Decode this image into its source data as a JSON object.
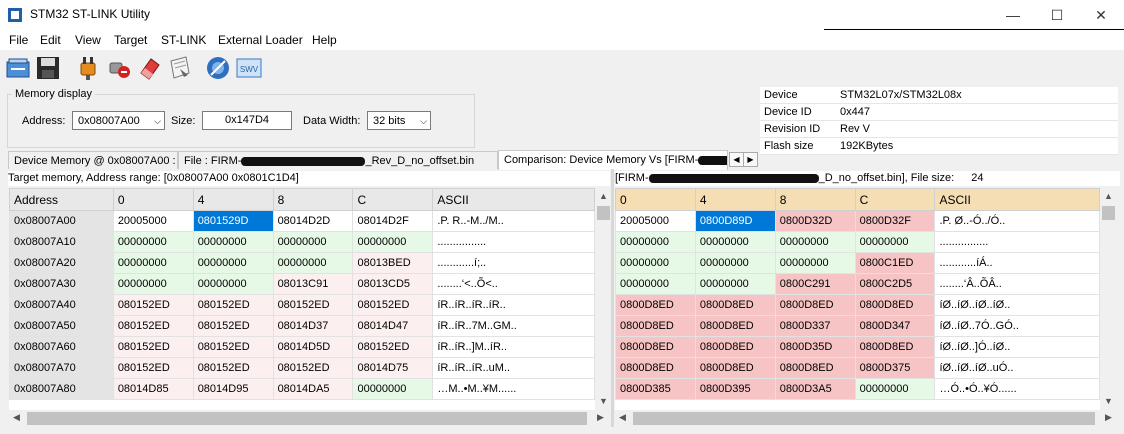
{
  "window": {
    "title": "STM32 ST-LINK Utility",
    "controls": [
      "—",
      "☐",
      "✕"
    ]
  },
  "menu": [
    "File",
    "Edit",
    "View",
    "Target",
    "ST-LINK",
    "External Loader",
    "Help"
  ],
  "toolbar": {
    "icons": [
      "open-file-icon",
      "save-icon",
      "connect-icon",
      "disconnect-icon",
      "erase-icon",
      "program-icon",
      "target-icon",
      "swv-icon"
    ],
    "swv_label": "SWV"
  },
  "memory_display": {
    "group_title": "Memory display",
    "address_label": "Address:",
    "address_value": "0x08007A00",
    "size_label": "Size:",
    "size_value": "0x147D4",
    "width_label": "Data Width:",
    "width_value": "32 bits"
  },
  "device_info": [
    {
      "key": "Device",
      "value": "STM32L07x/STM32L08x"
    },
    {
      "key": "Device ID",
      "value": "0x447"
    },
    {
      "key": "Revision ID",
      "value": "Rev V"
    },
    {
      "key": "Flash size",
      "value": "192KBytes"
    }
  ],
  "tabs": {
    "device_memory": "Device Memory @ 0x08007A00 :",
    "file_prefix": "File : FIRM-",
    "file_suffix": "_Rev_D_no_offset.bin",
    "comparison": "Comparison: Device Memory Vs [FIRM-"
  },
  "left_pane": {
    "info": "Target memory, Address range: [0x08007A00 0x0801C1D4]",
    "headers": [
      "Address",
      "0",
      "4",
      "8",
      "C",
      "ASCII"
    ],
    "rows": [
      [
        "0x08007A00",
        "20005000",
        "0801529D",
        "08014D2D",
        "08014D2F",
        ".P.  R..-M../M.."
      ],
      [
        "0x08007A10",
        "00000000",
        "00000000",
        "00000000",
        "00000000",
        "................"
      ],
      [
        "0x08007A20",
        "00000000",
        "00000000",
        "00000000",
        "08013BED",
        "............í;.."
      ],
      [
        "0x08007A30",
        "00000000",
        "00000000",
        "08013C91",
        "08013CD5",
        "........‘<..Õ<.."
      ],
      [
        "0x08007A40",
        "080152ED",
        "080152ED",
        "080152ED",
        "080152ED",
        "íR..íR..íR..íR.."
      ],
      [
        "0x08007A50",
        "080152ED",
        "080152ED",
        "08014D37",
        "08014D47",
        "íR..íR..7M..GM.."
      ],
      [
        "0x08007A60",
        "080152ED",
        "080152ED",
        "08014D5D",
        "080152ED",
        "íR..íR..]M..íR.."
      ],
      [
        "0x08007A70",
        "080152ED",
        "080152ED",
        "080152ED",
        "08014D75",
        "íR..íR..íR..uM.."
      ],
      [
        "0x08007A80",
        "08014D85",
        "08014D95",
        "08014DA5",
        "00000000",
        "…M..•M..¥M......"
      ]
    ],
    "row_colors": [
      [
        "w",
        "sel",
        "w",
        "w",
        "w"
      ],
      [
        "g",
        "g",
        "g",
        "g",
        "w"
      ],
      [
        "g",
        "g",
        "g",
        "p",
        "w"
      ],
      [
        "g",
        "g",
        "p",
        "p",
        "w"
      ],
      [
        "p",
        "p",
        "p",
        "p",
        "w"
      ],
      [
        "p",
        "p",
        "p",
        "p",
        "w"
      ],
      [
        "p",
        "p",
        "p",
        "p",
        "w"
      ],
      [
        "p",
        "p",
        "p",
        "p",
        "w"
      ],
      [
        "p",
        "p",
        "p",
        "g",
        "w"
      ]
    ]
  },
  "right_pane": {
    "info_prefix": "[FIRM-",
    "info_suffix": "_D_no_offset.bin], File size:",
    "file_size": "24",
    "headers": [
      "0",
      "4",
      "8",
      "C",
      "ASCII"
    ],
    "rows": [
      [
        "20005000",
        "0800D89D",
        "0800D32D",
        "0800D32F",
        ".P.  Ø..-Ó../Ó.."
      ],
      [
        "00000000",
        "00000000",
        "00000000",
        "00000000",
        "................"
      ],
      [
        "00000000",
        "00000000",
        "00000000",
        "0800C1ED",
        "............íÁ.."
      ],
      [
        "00000000",
        "00000000",
        "0800C291",
        "0800C2D5",
        "........‘Â..ÕÂ.."
      ],
      [
        "0800D8ED",
        "0800D8ED",
        "0800D8ED",
        "0800D8ED",
        "íØ..íØ..íØ..íØ.."
      ],
      [
        "0800D8ED",
        "0800D8ED",
        "0800D337",
        "0800D347",
        "íØ..íØ..7Ó..GÓ.."
      ],
      [
        "0800D8ED",
        "0800D8ED",
        "0800D35D",
        "0800D8ED",
        "íØ..íØ..]Ó..íØ.."
      ],
      [
        "0800D8ED",
        "0800D8ED",
        "0800D8ED",
        "0800D375",
        "íØ..íØ..íØ..uÓ.."
      ],
      [
        "0800D385",
        "0800D395",
        "0800D3A5",
        "00000000",
        "…Ó..•Ó..¥Ó......"
      ]
    ],
    "row_colors": [
      [
        "w",
        "sel",
        "r",
        "r",
        "w"
      ],
      [
        "g",
        "g",
        "g",
        "g",
        "w"
      ],
      [
        "g",
        "g",
        "g",
        "r",
        "w"
      ],
      [
        "g",
        "g",
        "r",
        "r",
        "w"
      ],
      [
        "r",
        "r",
        "r",
        "r",
        "w"
      ],
      [
        "r",
        "r",
        "r",
        "r",
        "w"
      ],
      [
        "r",
        "r",
        "r",
        "r",
        "w"
      ],
      [
        "r",
        "r",
        "r",
        "r",
        "w"
      ],
      [
        "r",
        "r",
        "r",
        "g",
        "w"
      ]
    ]
  },
  "colors": {
    "selection": "#0078d7",
    "match_green": "#e6f8e6",
    "diff_red": "#f6c4c4",
    "header_tan": "#f5deb3"
  }
}
